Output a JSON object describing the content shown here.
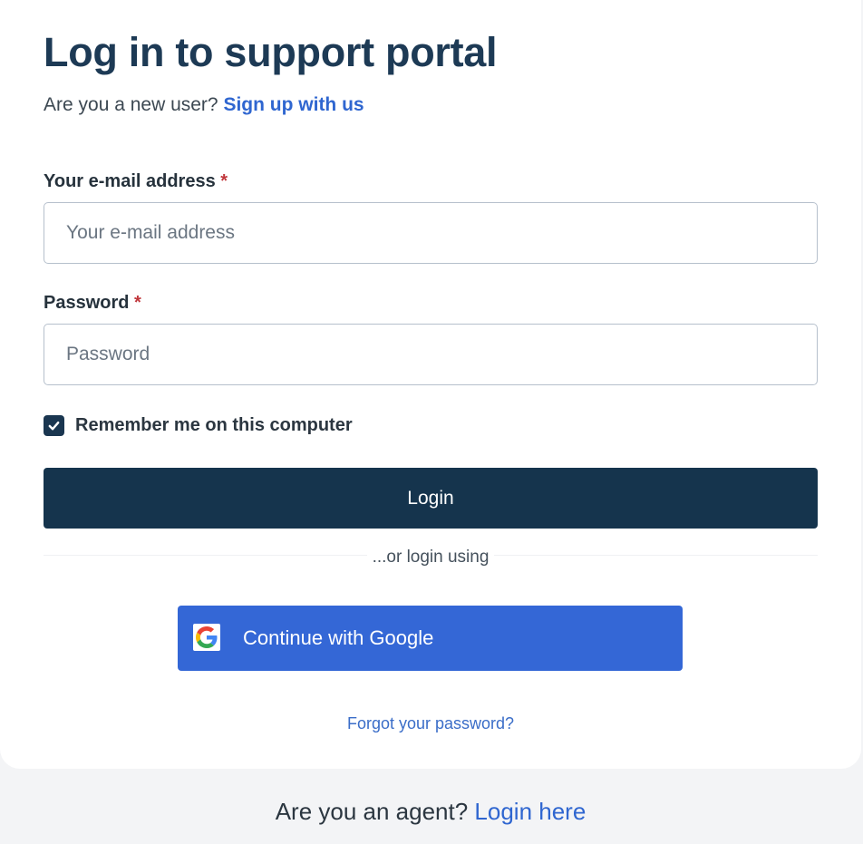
{
  "login": {
    "title": "Log in to support portal",
    "new_user_prompt": "Are you a new user? ",
    "signup_link": "Sign up with us",
    "email_label": "Your e-mail address",
    "email_placeholder": "Your e-mail address",
    "email_value": "",
    "password_label": "Password",
    "password_placeholder": "Password",
    "password_value": "",
    "required_marker": "*",
    "remember_label": "Remember me on this computer",
    "remember_checked": true,
    "login_button": "Login",
    "alt_login_text": "...or login using",
    "google_button": "Continue with Google",
    "forgot_link": "Forgot your password?"
  },
  "agent": {
    "prompt": "Are you an agent? ",
    "link": "Login here"
  },
  "icons": {
    "checkbox": "check-icon",
    "google": "google-logo-icon"
  },
  "colors": {
    "title": "#1d3a55",
    "link": "#2f66d0",
    "primary_button": "#15344d",
    "google_button": "#3467d6",
    "required": "#c0363b"
  }
}
